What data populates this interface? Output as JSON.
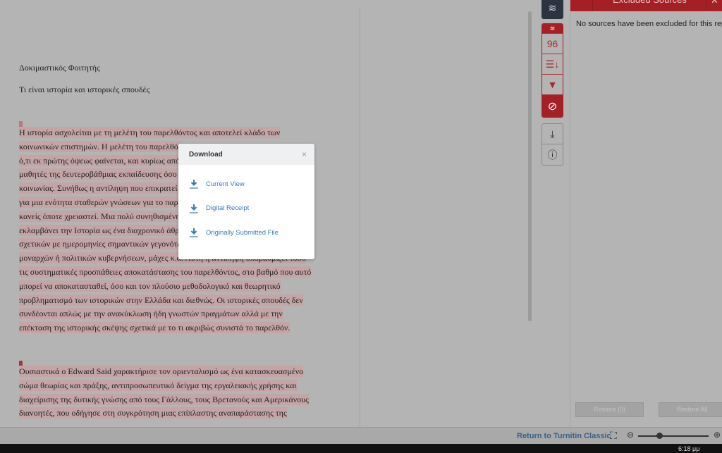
{
  "document": {
    "author": "Δοκιμαστικός Φοιτητής",
    "title": "Τι είναι ιστορία και ιστορικές σπουδές",
    "paragraph1": [
      "Η ιστορία ασχολείται με τη μελέτη του παρελθόντος και αποτελεί κλάδο των",
      "κοινωνικών επιστημών.  Η μελέτη του παρελθόν",
      "ό,τι εκ πρώτης όψεως φαίνεται, και κυρίως από τ",
      "μαθητές της δευτεροβάθμιας εκπαίδευσης όσο κ",
      "κοινωνίας.  Συνήθως η αντίληψη που επικρατεί γ",
      "για μια ενότητα σταθερών γνώσεων για το παρελ",
      "κανείς όποτε χρειαστεί.  Μια πολύ συνηθισμένη",
      "εκλαμβάνει την Ιστορία ως ένα διαχρονικό άθροι",
      "σχετικών με ημερομηνίες σημαντικών γεγονότων",
      "μοναρχών ή πολιτικών κυβερνήσεων, μάχες κ.ά.  Αυτή η αντίληψη υποβαθμίζει τόσο",
      "τις συστηματικές προσπάθειες αποκατάστασης του παρελθόντος, στο βαθμό που αυτό",
      "μπορεί να αποκατασταθεί, όσο και τον πλούσιο μεθοδολογικό και θεωρητικό",
      "προβληματισμό των ιστορικών στην Ελλάδα και διεθνώς.  Οι ιστορικές σπουδές δεν",
      "συνδέονται απλώς με την ανακύκλωση ήδη γνωστών πραγμάτων αλλά με την",
      "επέκταση της ιστορικής σκέψης σχετικά με το τι ακριβώς συνιστά το παρελθόν."
    ],
    "paragraph2": [
      "Ουσιαστικά ο Edward Said χαρακτήρισε τον οριενταλισμό ως ένα κατασκευασμένο",
      "σώμα θεωρίας και πράξης, αντιπροσωπευτικό δείγμα της εργαλειακής χρήσης και",
      "διαχείρισης της δυτικής γνώσης από τους Γάλλους, τους Βρετανούς και Αμερικάνους",
      "διανοητές, που οδήγησε στη συγκρότηση μιας επίπλαστης αναπαράστασης της"
    ]
  },
  "toolbar": {
    "layers_icon": "layers-icon",
    "similarity_score": "96",
    "icons": [
      "layers-icon",
      "sort-icon",
      "filter-icon",
      "exclude-icon",
      "download-icon",
      "info-icon"
    ]
  },
  "panel": {
    "title": "Excluded Sources",
    "message": "No sources have been excluded for this report.",
    "restore_button": "Restore (0)",
    "restore_all_button": "Restore All"
  },
  "bottom": {
    "return_link": "Return to Turnitin Classic",
    "zoom_level": 0.3
  },
  "taskbar": {
    "clock": "6:18 μμ"
  },
  "modal": {
    "title": "Download",
    "close": "×",
    "items": [
      {
        "label": "Current View"
      },
      {
        "label": "Digital Receipt"
      },
      {
        "label": "Originally Submitted File"
      }
    ]
  },
  "colors": {
    "accent": "#a52025",
    "link": "#3a7ab8",
    "highlight": "#c5a4a6"
  }
}
